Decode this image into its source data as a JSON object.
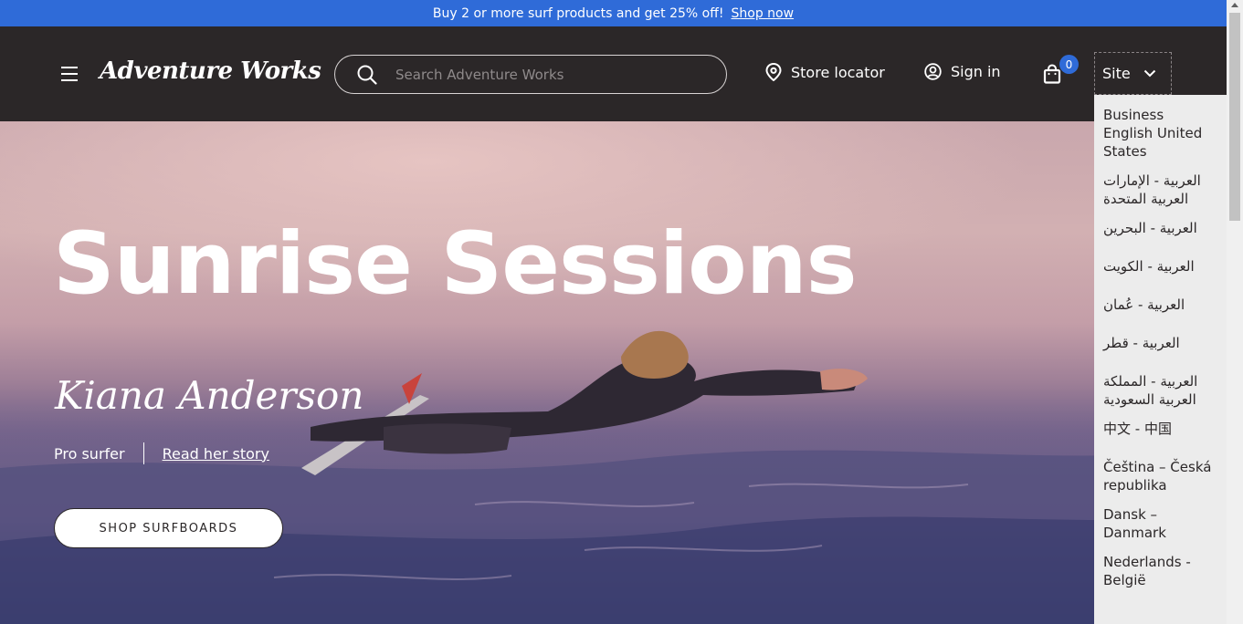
{
  "promo": {
    "text": "Buy 2 or more surf products and get 25% off!",
    "link": "Shop now",
    "bg_color": "#2f6bd8"
  },
  "header": {
    "logo": "Adventure Works",
    "search_placeholder": "Search Adventure Works",
    "store_locator": "Store locator",
    "sign_in": "Sign in",
    "cart_count": "0",
    "site_label": "Site",
    "bg_color": "#2b2728"
  },
  "hero": {
    "title": "Sunrise Sessions",
    "signature": "Kiana Anderson",
    "role": "Pro surfer",
    "story_link": "Read her story",
    "cta": "SHOP SURFBOARDS"
  },
  "site_menu": {
    "items": [
      "Business English United States",
      "العربية - الإمارات العربية المتحدة",
      "العربية - البحرين",
      "العربية - الكويت",
      "العربية - عُمان",
      "العربية - قطر",
      "العربية - المملكة العربية السعودية",
      "中文 - 中国",
      "Čeština – Česká republika",
      "Dansk – Danmark",
      "Nederlands - België"
    ]
  }
}
